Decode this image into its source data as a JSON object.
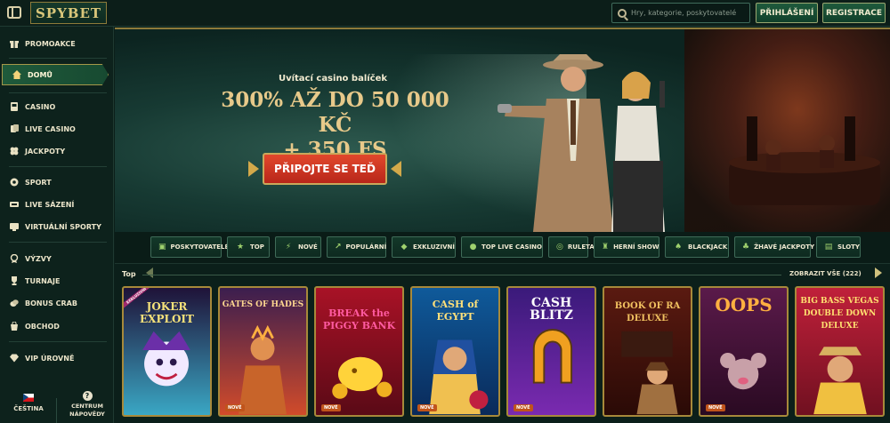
{
  "header": {
    "logo": "SPYBET",
    "search_placeholder": "Hry, kategorie, poskytovatelé",
    "login_label": "PŘIHLÁŠENÍ",
    "register_label": "REGISTRACE"
  },
  "sidebar": {
    "items": [
      {
        "label": "PROMOAKCE",
        "icon": "gift-icon"
      },
      {
        "label": "DOMŮ",
        "icon": "home-icon",
        "active": true
      },
      {
        "label": "CASINO",
        "icon": "slot-icon"
      },
      {
        "label": "LIVE CASINO",
        "icon": "cards-icon"
      },
      {
        "label": "JACKPOTY",
        "icon": "clover-icon"
      },
      {
        "label": "SPORT",
        "icon": "football-icon"
      },
      {
        "label": "LIVE SÁZENÍ",
        "icon": "live-icon"
      },
      {
        "label": "VIRTUÁLNÍ SPORTY",
        "icon": "virtual-icon"
      },
      {
        "label": "VÝZVY",
        "icon": "medal-icon"
      },
      {
        "label": "TURNAJE",
        "icon": "trophy-icon"
      },
      {
        "label": "BONUS CRAB",
        "icon": "coins-icon"
      },
      {
        "label": "OBCHOD",
        "icon": "shop-icon"
      },
      {
        "label": "VIP ÚROVNĚ",
        "icon": "diamond-icon"
      }
    ],
    "language": "ČEŠTINA",
    "help_line1": "CENTRUM",
    "help_line2": "NÁPOVĚDY"
  },
  "banner": {
    "tagline": "Uvítací casino balíček",
    "headline_line1": "300% AŽ DO 50 000 KČ",
    "headline_line2": "+ 350 FS",
    "cta_label": "PŘIPOJTE SE TEĎ"
  },
  "categories": [
    {
      "label": "POSKYTOVATELÉ",
      "icon": "provider-icon"
    },
    {
      "label": "TOP",
      "icon": "star-icon"
    },
    {
      "label": "NOVÉ",
      "icon": "new-icon"
    },
    {
      "label": "POPULÁRNÍ",
      "icon": "popular-icon"
    },
    {
      "label": "EXKLUZIVNÍ",
      "icon": "diamond-icon"
    },
    {
      "label": "TOP LIVE CASINO",
      "icon": "live-casino-icon"
    },
    {
      "label": "RULETA",
      "icon": "roulette-icon"
    },
    {
      "label": "HERNÍ SHOW",
      "icon": "show-icon"
    },
    {
      "label": "BLACKJACK",
      "icon": "blackjack-icon"
    },
    {
      "label": "ŽHAVÉ JACKPOTY",
      "icon": "jackpot-icon"
    },
    {
      "label": "SLOTY",
      "icon": "slots-icon"
    }
  ],
  "games_section": {
    "title": "Top",
    "show_all": "ZOBRAZIT VŠE (222)",
    "tiles": [
      {
        "title": "JOKER EXPLOIT",
        "badge": "",
        "exclusive": "EXKLUZIVNÍ",
        "colors": [
          "#1f1238",
          "#3aa7c4"
        ]
      },
      {
        "title": "GATES OF HADES",
        "badge": "NOVÉ",
        "exclusive": "",
        "colors": [
          "#3b1e4f",
          "#d14b2a"
        ]
      },
      {
        "title": "BREAK the PIGGY BANK",
        "badge": "NOVÉ",
        "exclusive": "",
        "colors": [
          "#a81226",
          "#ffd33a"
        ]
      },
      {
        "title": "CASH of EGYPT",
        "badge": "NOVÉ",
        "exclusive": "",
        "colors": [
          "#0f5a9a",
          "#f0c050"
        ]
      },
      {
        "title": "CASH BLITZ",
        "badge": "NOVÉ",
        "exclusive": "",
        "colors": [
          "#3a1a7a",
          "#f0a020"
        ]
      },
      {
        "title": "BOOK OF RA DELUXE",
        "badge": "",
        "exclusive": "",
        "colors": [
          "#5a1a10",
          "#e0a040"
        ]
      },
      {
        "title": "OOPS",
        "badge": "NOVÉ",
        "exclusive": "",
        "colors": [
          "#5a1a4a",
          "#ffb040"
        ]
      },
      {
        "title": "BIG BASS VEGAS DOUBLE DOWN DELUXE",
        "badge": "",
        "exclusive": "",
        "colors": [
          "#c0203a",
          "#f0c040"
        ]
      }
    ]
  },
  "colors": {
    "accent_gold": "#a7893a",
    "cta_red": "#d23a22",
    "bg": "#0b1f1a"
  }
}
